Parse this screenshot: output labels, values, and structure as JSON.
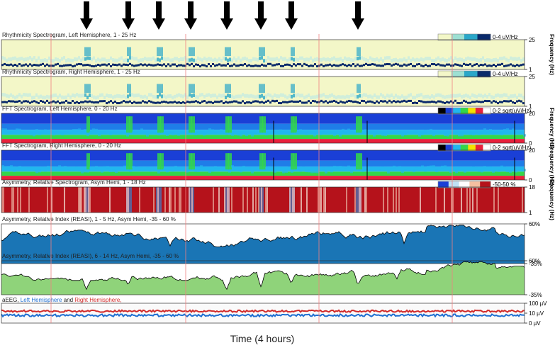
{
  "chart_data": {
    "type": "spectrogram-montage",
    "xlabel": "Time (4 hours)",
    "arrows": [
      122,
      181,
      224,
      269,
      320,
      368,
      411,
      505
    ],
    "red_markers": [
      72,
      262,
      450,
      638
    ],
    "panels": [
      {
        "id": "rhythm_left",
        "type": "heatmap",
        "title": "Rhythmicity Spectrogram, Left Hemisphere, 1 - 25 Hz",
        "scale_label": "0-4 uV/Hz",
        "yticks": [
          "25",
          "1"
        ],
        "ylabel": "Frequency (Hz)"
      },
      {
        "id": "rhythm_right",
        "type": "heatmap",
        "title": "Rhythmicity Spectrogram, Right Hemisphere, 1 - 25 Hz",
        "scale_label": "0-4 uV/Hz",
        "yticks": [
          "25",
          "1"
        ],
        "ylabel": ""
      },
      {
        "id": "fft_left",
        "type": "heatmap",
        "title": "FFT Spectrogram, Left Hemisphere, 0 - 20 Hz",
        "scale_label": "0-2 sqrt(uV/Hz)",
        "yticks": [
          "20",
          "0"
        ],
        "ylabel": "Frequency (Hz)"
      },
      {
        "id": "fft_right",
        "type": "heatmap",
        "title": "FFT Spectrogram, Right Hemisphere, 0 - 20 Hz",
        "scale_label": "0-2 sqrt(uV/Hz)",
        "yticks": [
          "20",
          "0"
        ],
        "ylabel": "Frequency (Hz)"
      },
      {
        "id": "asym_spec",
        "type": "heatmap",
        "title": "Asymmetry, Relative Spectrogram, Asym Hemi, 1 - 18 Hz",
        "scale_label": "-50-50 %",
        "yticks": [
          "18",
          "1"
        ],
        "ylabel": "Frequency (Hz)"
      },
      {
        "id": "reasi_low",
        "type": "area",
        "title": "Asymmetry, Relative Index (REASI), 1 - 5 Hz, Asym Hemi, -35 - 60 %",
        "yticks": [
          "60%",
          "-35%"
        ],
        "ylim": [
          -35,
          60
        ],
        "color": "#1a75b5"
      },
      {
        "id": "reasi_high",
        "type": "area",
        "title": "Asymmetry, Relative Index (REASI), 6 - 14 Hz, Asym Hemi, -35 - 60 %",
        "yticks": [
          "60%",
          "-35%"
        ],
        "ylim": [
          -35,
          60
        ],
        "color": "#8fd37a"
      },
      {
        "id": "aeeg",
        "type": "line",
        "title_parts": [
          "aEEG, ",
          "Left Hemisphere",
          " and ",
          "Right Hemisphere,"
        ],
        "yticks": [
          "100 µV",
          "10 µV",
          "0 µV"
        ]
      }
    ]
  },
  "colors": {
    "rhythm_bg": "#f3f7c8",
    "rhythm_accent": "#2aa7c9",
    "rhythm_dark": "#0a2a6b",
    "fft_blue": "#1a3fd6",
    "fft_cyan": "#21b7ee",
    "fft_green": "#33d64a",
    "fft_red": "#e8203b",
    "asym_red": "#b5121b",
    "asym_blue": "#3f7fc4",
    "aeeg_left": "#1f6fd1",
    "aeeg_right": "#d12a2a",
    "marker": "#f08080"
  }
}
